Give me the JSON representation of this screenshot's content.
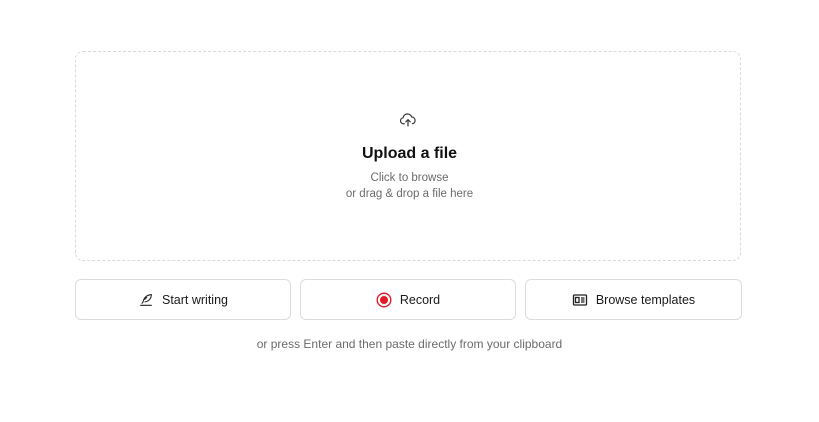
{
  "upload": {
    "icon": "cloud-upload-icon",
    "title": "Upload a file",
    "line1": "Click to browse",
    "line2": "or drag & drop a file here"
  },
  "actions": [
    {
      "label": "Start writing",
      "icon": "pen-icon"
    },
    {
      "label": "Record",
      "icon": "record-icon",
      "accent": "#e01b24"
    },
    {
      "label": "Browse templates",
      "icon": "template-icon"
    }
  ],
  "hint": "or press Enter and then paste directly from your clipboard"
}
